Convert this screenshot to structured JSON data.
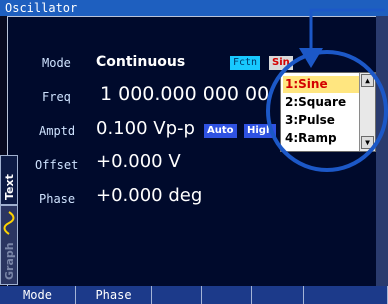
{
  "window": {
    "title": "Oscillator"
  },
  "rows": {
    "mode": {
      "label": "Mode",
      "value": "Continuous"
    },
    "freq": {
      "label": "Freq",
      "value": "1 000.000 000 00"
    },
    "amptd": {
      "label": "Amptd",
      "value": "0.100 Vp-p"
    },
    "offset": {
      "label": "Offset",
      "value": "+0.000 V"
    },
    "phase": {
      "label": "Phase",
      "value": "+0.000 deg"
    }
  },
  "chips": {
    "fctn": "Fctn",
    "auto": "Auto",
    "high": "High",
    "sine": "Sin"
  },
  "side_tabs": {
    "text": "Text",
    "graph": "Graph"
  },
  "dropdown": {
    "items": [
      "1:Sine",
      "2:Square",
      "3:Pulse",
      "4:Ramp"
    ],
    "selected": "1:Sine"
  },
  "softkeys": [
    "Mode",
    "Phase",
    "",
    "",
    "",
    ""
  ],
  "colors": {
    "title_bar": "#1e5fbf",
    "highlight_circle": "#1c58c7",
    "selected_item": "#d40000"
  },
  "icons": [
    "scroll-up-arrow-icon",
    "scroll-down-arrow-icon",
    "pointer-arrow-icon",
    "sine-wave-icon"
  ]
}
